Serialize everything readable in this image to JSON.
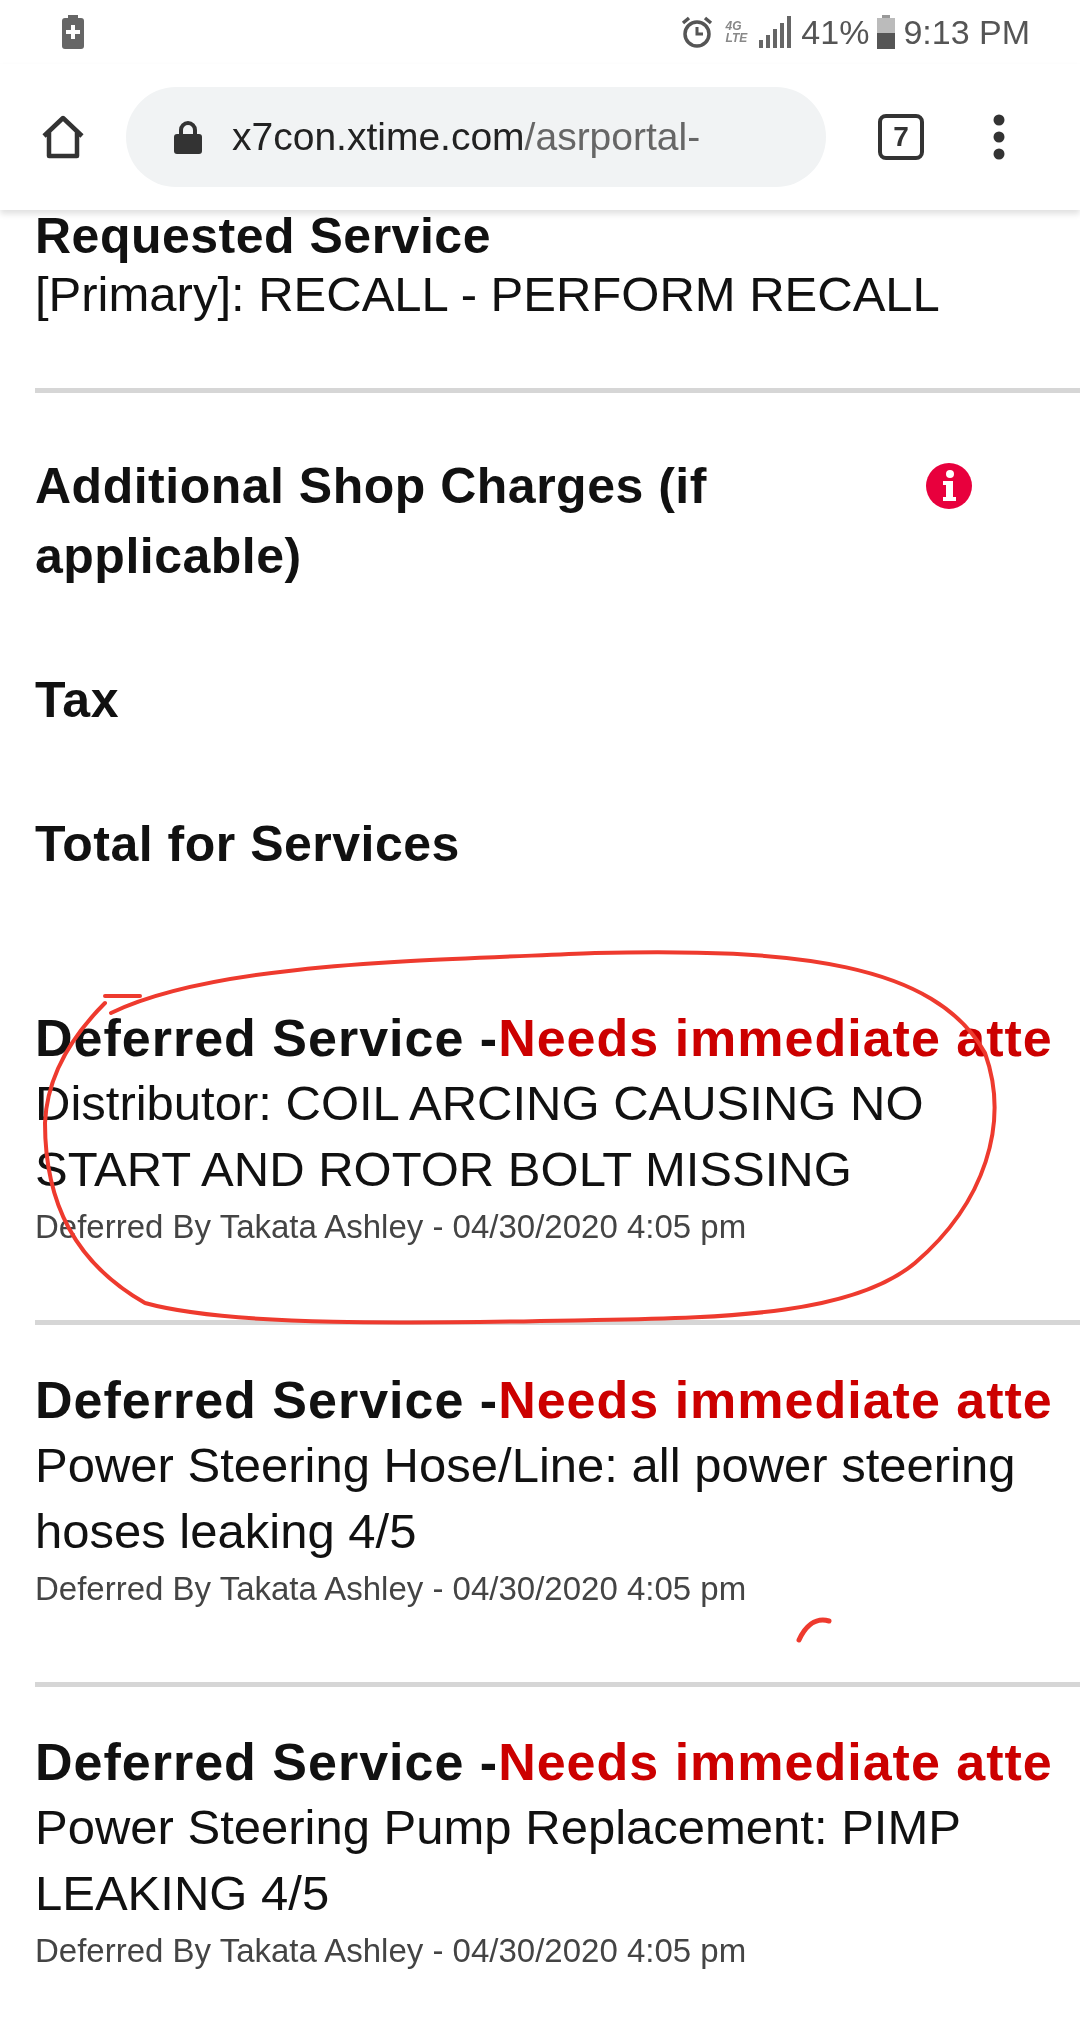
{
  "status_bar": {
    "network_type": [
      "4G",
      "LTE"
    ],
    "battery": "41%",
    "time": "9:13 PM"
  },
  "browser": {
    "url_host": "x7con.xtime.com",
    "url_path": "/asrportal-",
    "tab_count": "7"
  },
  "requested_service": {
    "title": "Requested Service",
    "value": "[Primary]: RECALL - PERFORM RECALL"
  },
  "charges": [
    {
      "label": "Additional Shop Charges (if applicable)",
      "info": true
    },
    {
      "label": "Tax",
      "info": false
    },
    {
      "label": "Total for Services",
      "info": false
    }
  ],
  "deferred_services": [
    {
      "title": "Deferred Service -",
      "urgency": "Needs immediate atte",
      "description": "Distributor: COIL ARCING CAUSING NO START AND ROTOR BOLT MISSING",
      "meta": "Deferred By Takata Ashley - 04/30/2020 4:05 pm",
      "circled": true,
      "pen_mark": false
    },
    {
      "title": "Deferred Service -",
      "urgency": "Needs immediate atte",
      "description": "Power Steering Hose/Line: all power steering hoses leaking 4/5",
      "meta": "Deferred By Takata Ashley - 04/30/2020 4:05 pm",
      "circled": false,
      "pen_mark": true
    },
    {
      "title": "Deferred Service -",
      "urgency": "Needs immediate atte",
      "description": "Power Steering Pump Replacement: PIMP LEAKING 4/5",
      "meta": "Deferred By Takata Ashley - 04/30/2020 4:05 pm",
      "circled": false,
      "pen_mark": false
    }
  ]
}
